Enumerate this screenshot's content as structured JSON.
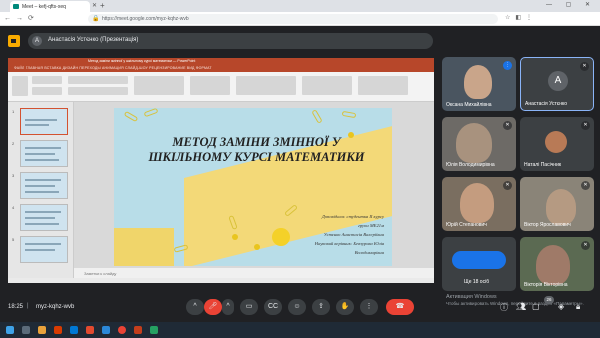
{
  "browser": {
    "tab_title": "Meet – kefj-qfts-xeq",
    "url": "https://meet.google.com/myz-kqhz-wvb",
    "window_controls": "— ▢ ✕"
  },
  "meet": {
    "presenter_initial": "A",
    "presenter_banner": "Анастасія Устєнко (Презентація)",
    "time": "18:25",
    "meeting_code": "myz-kqhz-wvb",
    "activate_windows": "Активация Windows",
    "activate_windows_sub": "Чтобы активировать Windows, перейдите в раздел «Параметры».",
    "participants_count": "26"
  },
  "ppt": {
    "title_bar": "Метод заміни змінної у шкільному курсі математики — PowerPoint",
    "tabs": "ФАЙЛ   ГЛАВНАЯ   ВСТАВКА   ДИЗАЙН   ПЕРЕХОДЫ   АНИМАЦИЯ   СЛАЙД-ШОУ   РЕЦЕНЗИРОВАНИЕ   ВИД   ФОРМАТ",
    "notes_placeholder": "Заметки к слайду"
  },
  "slide": {
    "title": "МЕТОД ЗАМІНИ ЗМІННОЇ У ШКІЛЬНОМУ КУРСІ МАТЕМАТИКИ",
    "line1": "Доповідала: студентка II курсу",
    "line2": "групи МЕ21м",
    "line3": "Устєнко Анастасія Валеріївна",
    "line4": "Науковий керівник: Бевзурова Юлія",
    "line5": "Володимирівна"
  },
  "participants": [
    {
      "name": "Оксана Михайлівна",
      "type": "video"
    },
    {
      "name": "Анастасія Устєнко",
      "type": "avatar",
      "initial": "A",
      "color": "#5f6368"
    },
    {
      "name": "Юлія Володимирівна",
      "type": "video"
    },
    {
      "name": "Наталі Пасічник",
      "type": "video"
    },
    {
      "name": "Юрій Степанович",
      "type": "video"
    },
    {
      "name": "Віктор Ярославович",
      "type": "video"
    },
    {
      "name": "Ще 18 осіб",
      "type": "more"
    },
    {
      "name": "Вікторія Вікторівна",
      "type": "video"
    }
  ],
  "colors": {
    "meet_bg": "#202124",
    "ppt_accent": "#b7472a",
    "hangup": "#ea4335",
    "slide_blue": "#b8dde8",
    "slide_yellow": "#f3d978"
  }
}
